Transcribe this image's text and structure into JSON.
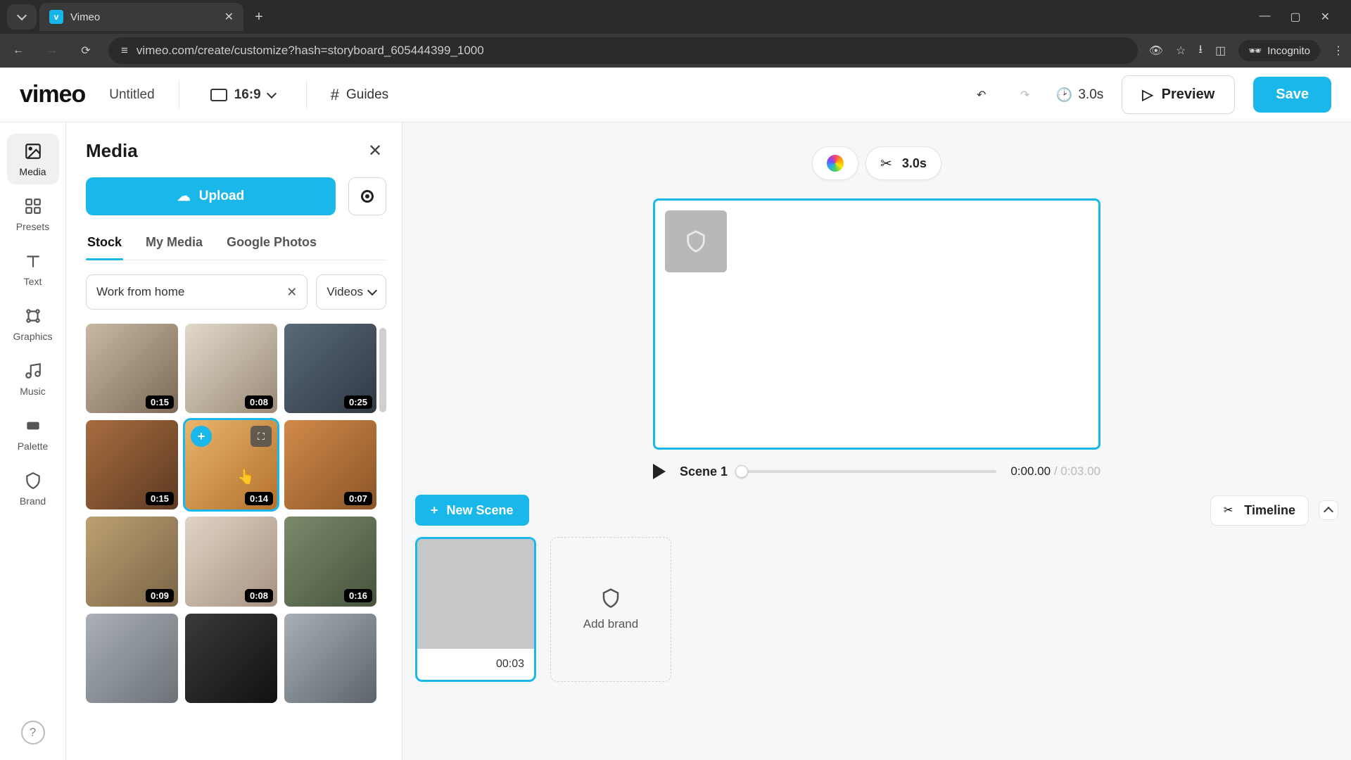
{
  "browser": {
    "tab_title": "Vimeo",
    "new_tab": "+",
    "url": "vimeo.com/create/customize?hash=storyboard_605444399_1000",
    "incognito_label": "Incognito"
  },
  "header": {
    "logo": "vimeo",
    "project_title": "Untitled",
    "aspect_ratio": "16:9",
    "guides": "Guides",
    "duration": "3.0s",
    "preview": "Preview",
    "save": "Save"
  },
  "rail": {
    "items": [
      {
        "label": "Media"
      },
      {
        "label": "Presets"
      },
      {
        "label": "Text"
      },
      {
        "label": "Graphics"
      },
      {
        "label": "Music"
      },
      {
        "label": "Palette"
      },
      {
        "label": "Brand"
      }
    ]
  },
  "panel": {
    "title": "Media",
    "upload": "Upload",
    "tabs": [
      "Stock",
      "My Media",
      "Google Photos"
    ],
    "active_tab": 0,
    "search_value": "Work from home",
    "filter_value": "Videos",
    "media": [
      {
        "duration": "0:15",
        "selected": false
      },
      {
        "duration": "0:08",
        "selected": false
      },
      {
        "duration": "0:25",
        "selected": false
      },
      {
        "duration": "0:15",
        "selected": false
      },
      {
        "duration": "0:14",
        "selected": true
      },
      {
        "duration": "0:07",
        "selected": false
      },
      {
        "duration": "0:09",
        "selected": false
      },
      {
        "duration": "0:08",
        "selected": false
      },
      {
        "duration": "0:16",
        "selected": false
      },
      {
        "duration": "",
        "selected": false
      },
      {
        "duration": "",
        "selected": false
      },
      {
        "duration": "",
        "selected": false
      }
    ]
  },
  "canvas": {
    "toolbar_duration": "3.0s",
    "scene_label": "Scene 1",
    "current_time": "0:00.00",
    "total_time": "0:03.00"
  },
  "timeline": {
    "new_scene": "New Scene",
    "timeline_label": "Timeline",
    "scene_time": "00:03",
    "add_brand": "Add brand"
  }
}
